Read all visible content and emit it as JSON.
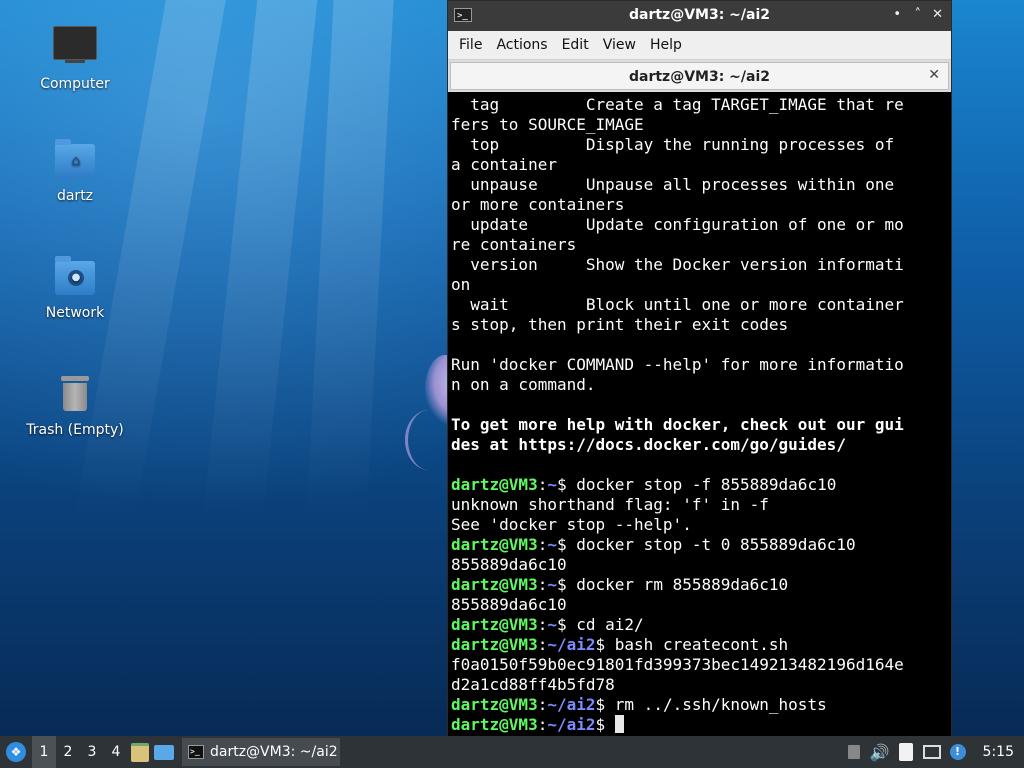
{
  "desktop": {
    "icons": [
      {
        "label": "Computer",
        "icon": "computer-icon"
      },
      {
        "label": "dartz",
        "icon": "home-folder-icon"
      },
      {
        "label": "Network",
        "icon": "network-folder-icon"
      },
      {
        "label": "Trash (Empty)",
        "icon": "trash-icon"
      }
    ]
  },
  "window": {
    "title": "dartz@VM3: ~/ai2",
    "controls": {
      "minimize": "•",
      "maximize": "˄",
      "close": "✕"
    },
    "menu": [
      "File",
      "Actions",
      "Edit",
      "View",
      "Help"
    ],
    "tab": {
      "title": "dartz@VM3: ~/ai2",
      "close": "✕"
    }
  },
  "terminal": {
    "output": [
      "  tag         Create a tag TARGET_IMAGE that re",
      "fers to SOURCE_IMAGE",
      "  top         Display the running processes of",
      "a container",
      "  unpause     Unpause all processes within one",
      "or more containers",
      "  update      Update configuration of one or mo",
      "re containers",
      "  version     Show the Docker version informati",
      "on",
      "  wait        Block until one or more container",
      "s stop, then print their exit codes",
      "",
      "Run 'docker COMMAND --help' for more informatio",
      "n on a command."
    ],
    "help_bold": [
      "To get more help with docker, check out our gui",
      "des at https://docs.docker.com/go/guides/"
    ],
    "session": [
      {
        "prompt": {
          "user": "dartz@VM3",
          "sep": ":",
          "path": "~",
          "sym": "$ "
        },
        "text": "docker stop -f 855889da6c10"
      },
      {
        "text": "unknown shorthand flag: 'f' in -f"
      },
      {
        "text": "See 'docker stop --help'."
      },
      {
        "prompt": {
          "user": "dartz@VM3",
          "sep": ":",
          "path": "~",
          "sym": "$ "
        },
        "text": "docker stop -t 0 855889da6c10"
      },
      {
        "text": "855889da6c10"
      },
      {
        "prompt": {
          "user": "dartz@VM3",
          "sep": ":",
          "path": "~",
          "sym": "$ "
        },
        "text": "docker rm 855889da6c10"
      },
      {
        "text": "855889da6c10"
      },
      {
        "prompt": {
          "user": "dartz@VM3",
          "sep": ":",
          "path": "~",
          "sym": "$ "
        },
        "text": "cd ai2/"
      },
      {
        "prompt": {
          "user": "dartz@VM3",
          "sep": ":",
          "path": "~/ai2",
          "sym": "$ "
        },
        "text": "bash createcont.sh"
      },
      {
        "text": "f0a0150f59b0ec91801fd399373bec149213482196d164e"
      },
      {
        "text": "d2a1cd88ff4b5fd78"
      },
      {
        "prompt": {
          "user": "dartz@VM3",
          "sep": ":",
          "path": "~/ai2",
          "sym": "$ "
        },
        "text": "rm ../.ssh/known_hosts"
      },
      {
        "prompt": {
          "user": "dartz@VM3",
          "sep": ":",
          "path": "~/ai2",
          "sym": "$ "
        },
        "text": "",
        "cursor": true
      }
    ]
  },
  "taskbar": {
    "start_icon": "lubuntu-start-icon",
    "workspaces": [
      "1",
      "2",
      "3",
      "4"
    ],
    "active_workspace": "1",
    "task_title": "dartz@VM3: ~/ai2",
    "clock": "5:15",
    "tray_icons": [
      "eject-icon",
      "volume-icon",
      "clipboard-icon",
      "network-icon",
      "update-notifier-icon"
    ]
  }
}
